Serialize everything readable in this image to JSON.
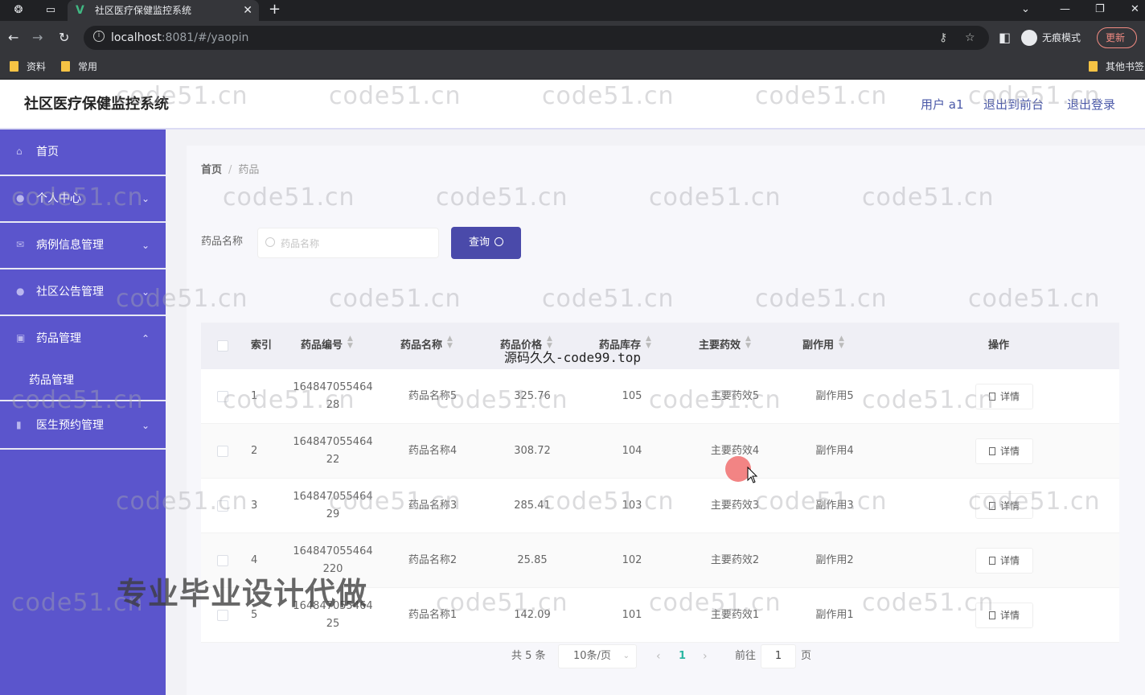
{
  "browser": {
    "tab_title": "社区医疗保健监控系统",
    "url_host": "localhost",
    "url_rest": ":8081/#/yaopin",
    "profile_label": "无痕模式",
    "update_label": "更新",
    "bookmarks": [
      "资料",
      "常用"
    ],
    "other_bookmarks": "其他书签"
  },
  "header": {
    "title": "社区医疗保健监控系统",
    "user": "用户 a1",
    "front_link": "退出到前台",
    "logout_link": "退出登录"
  },
  "sidebar": {
    "items": [
      {
        "label": "首页",
        "icon": "home-icon"
      },
      {
        "label": "个人中心",
        "icon": "user-icon"
      },
      {
        "label": "病例信息管理",
        "icon": "mail-icon"
      },
      {
        "label": "社区公告管理",
        "icon": "user-icon"
      },
      {
        "label": "药品管理",
        "icon": "briefcase-icon"
      },
      {
        "label": "医生预约管理",
        "icon": "bar-chart-icon"
      }
    ],
    "subitem": "药品管理"
  },
  "breadcrumb": {
    "home": "首页",
    "sep": "/",
    "current": "药品"
  },
  "search": {
    "label": "药品名称",
    "placeholder": "药品名称",
    "button": "查询"
  },
  "table": {
    "columns": [
      "索引",
      "药品编号",
      "药品名称",
      "药品价格",
      "药品库存",
      "主要药效",
      "副作用",
      "操作"
    ],
    "rows": [
      {
        "index": "1",
        "code_a": "164847055464",
        "code_b": "28",
        "name": "药品名称5",
        "price": "325.76",
        "stock": "105",
        "effect": "主要药效5",
        "side": "副作用5"
      },
      {
        "index": "2",
        "code_a": "164847055464",
        "code_b": "22",
        "name": "药品名称4",
        "price": "308.72",
        "stock": "104",
        "effect": "主要药效4",
        "side": "副作用4"
      },
      {
        "index": "3",
        "code_a": "164847055464",
        "code_b": "29",
        "name": "药品名称3",
        "price": "285.41",
        "stock": "103",
        "effect": "主要药效3",
        "side": "副作用3"
      },
      {
        "index": "4",
        "code_a": "164847055464",
        "code_b": "220",
        "name": "药品名称2",
        "price": "25.85",
        "stock": "102",
        "effect": "主要药效2",
        "side": "副作用2"
      },
      {
        "index": "5",
        "code_a": "164847055464",
        "code_b": "25",
        "name": "药品名称1",
        "price": "142.09",
        "stock": "101",
        "effect": "主要药效1",
        "side": "副作用1"
      }
    ],
    "detail_label": "详情"
  },
  "pagination": {
    "total": "共 5 条",
    "page_size": "10条/页",
    "current": "1",
    "goto": "前往",
    "goto_value": "1",
    "unit": "页"
  },
  "overlays": {
    "watermark": "code51.cn",
    "top_mark": "源码久久-code99.top",
    "big_mark": "专业毕业设计代做"
  }
}
